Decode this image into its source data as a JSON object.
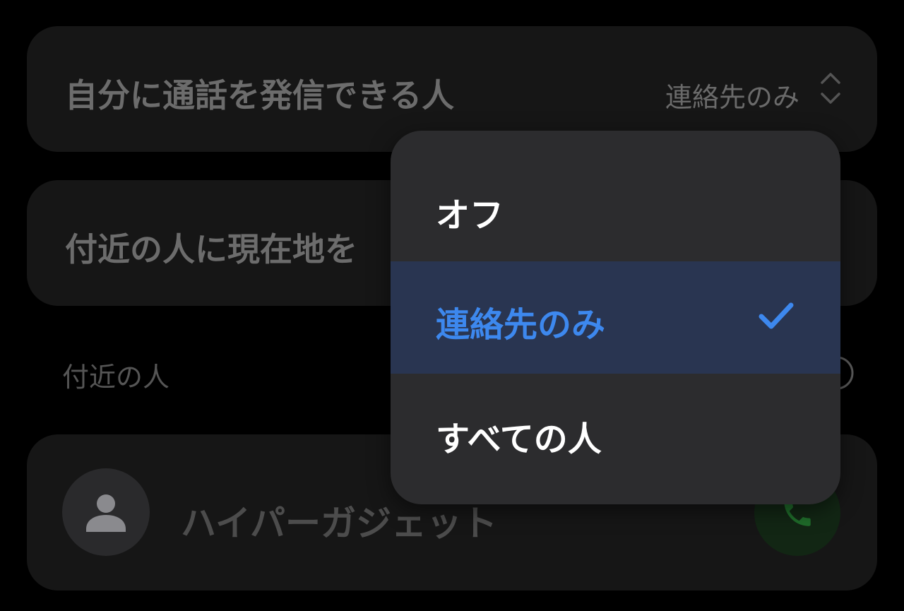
{
  "settings": {
    "call_row": {
      "label": "自分に通話を発信できる人",
      "value": "連絡先のみ",
      "icon": "chevron-up-down-icon"
    },
    "location_row": {
      "label": "付近の人に現在地を"
    },
    "nearby_section": {
      "header": "付近の人",
      "icon": "info-icon"
    },
    "person_card": {
      "name": "ハイパーガジェット",
      "avatar_icon": "person-icon",
      "call_icon": "phone-icon"
    }
  },
  "dropdown": {
    "options": [
      {
        "label": "オフ",
        "selected": false
      },
      {
        "label": "連絡先のみ",
        "selected": true,
        "icon": "checkmark-icon"
      },
      {
        "label": "すべての人",
        "selected": false
      }
    ]
  },
  "colors": {
    "background": "#000000",
    "card": "#161616",
    "menu": "#2c2c2e",
    "selected_row": "#293551",
    "accent": "#3d88ee",
    "call_green": "#1f6b2a"
  }
}
